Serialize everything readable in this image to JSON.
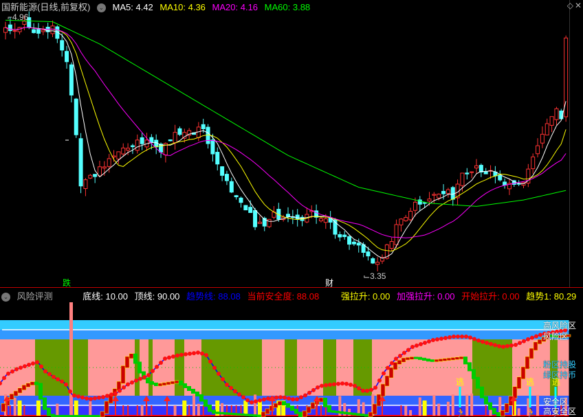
{
  "main_header": {
    "title": "国新能源(日线,前复权)",
    "ma5": "MA5: 4.42",
    "ma10": "MA10: 4.36",
    "ma20": "MA20: 4.16",
    "ma60": "MA60: 3.88"
  },
  "price_labels": {
    "high": "4.96",
    "low": "3.35"
  },
  "markers": {
    "die": "跌",
    "cai": "财"
  },
  "price_range": [
    3.35,
    4.96
  ],
  "price_keypoints": [
    [
      0,
      4.88
    ],
    [
      4,
      4.92
    ],
    [
      7,
      4.86
    ],
    [
      10,
      4.9
    ],
    [
      12,
      4.78
    ],
    [
      13,
      4.7
    ],
    [
      14,
      4.45
    ],
    [
      15,
      4.2
    ],
    [
      16,
      3.9
    ],
    [
      18,
      3.95
    ],
    [
      20,
      4.02
    ],
    [
      22,
      4.08
    ],
    [
      25,
      4.12
    ],
    [
      28,
      4.2
    ],
    [
      31,
      4.18
    ],
    [
      33,
      4.12
    ],
    [
      35,
      4.2
    ],
    [
      37,
      4.26
    ],
    [
      40,
      4.25
    ],
    [
      42,
      4.28
    ],
    [
      44,
      4.1
    ],
    [
      46,
      4.0
    ],
    [
      48,
      3.85
    ],
    [
      50,
      3.78
    ],
    [
      53,
      3.68
    ],
    [
      55,
      3.65
    ],
    [
      57,
      3.72
    ],
    [
      60,
      3.74
    ],
    [
      63,
      3.72
    ],
    [
      66,
      3.73
    ],
    [
      68,
      3.72
    ],
    [
      70,
      3.62
    ],
    [
      72,
      3.56
    ],
    [
      75,
      3.52
    ],
    [
      78,
      3.45
    ],
    [
      80,
      3.44
    ],
    [
      82,
      3.58
    ],
    [
      84,
      3.7
    ],
    [
      87,
      3.8
    ],
    [
      90,
      3.84
    ],
    [
      93,
      3.86
    ],
    [
      95,
      3.85
    ],
    [
      97,
      4.0
    ],
    [
      100,
      4.04
    ],
    [
      103,
      3.98
    ],
    [
      105,
      3.93
    ],
    [
      108,
      3.89
    ],
    [
      110,
      3.92
    ],
    [
      112,
      4.1
    ],
    [
      115,
      4.3
    ],
    [
      117,
      4.38
    ],
    [
      118,
      4.32
    ],
    [
      119,
      4.83
    ]
  ],
  "ma60_keypoints": [
    [
      0,
      4.95
    ],
    [
      10,
      4.94
    ],
    [
      20,
      4.8
    ],
    [
      40,
      4.45
    ],
    [
      60,
      4.1
    ],
    [
      75,
      3.9
    ],
    [
      90,
      3.8
    ],
    [
      100,
      3.78
    ],
    [
      110,
      3.82
    ],
    [
      119,
      3.88
    ]
  ],
  "sub_header": {
    "title": "风险评测",
    "bottom": "底线: 10.00",
    "top": "顶线: 90.00",
    "trend_line": "趋势线: 88.08",
    "safety": "当前安全度: 88.08",
    "strong_rise": "强拉升: 0.00",
    "stronger_rise": "加强拉升: 0.00",
    "start_rise": "开始拉升: 0.00",
    "trend1": "趋势1: 80.29"
  },
  "zones": {
    "high_risk": "高风险区",
    "risk": "风险区",
    "pink_hold": "粉区持股",
    "green_cash": "绿区持币",
    "safe": "安全区",
    "high_safe": "高安全区"
  },
  "escape_label": "逃",
  "colors": {
    "up": "#ff3232",
    "down": "#54ffff",
    "ma5": "#ffffff",
    "ma10": "#ffff00",
    "ma20": "#ff00ff",
    "ma60": "#00ff00",
    "pink": "#ff9999",
    "green": "#669900",
    "cyan_band": "#33ccff",
    "blue_band": "#3399ff",
    "safe_band": "#3366ff"
  }
}
